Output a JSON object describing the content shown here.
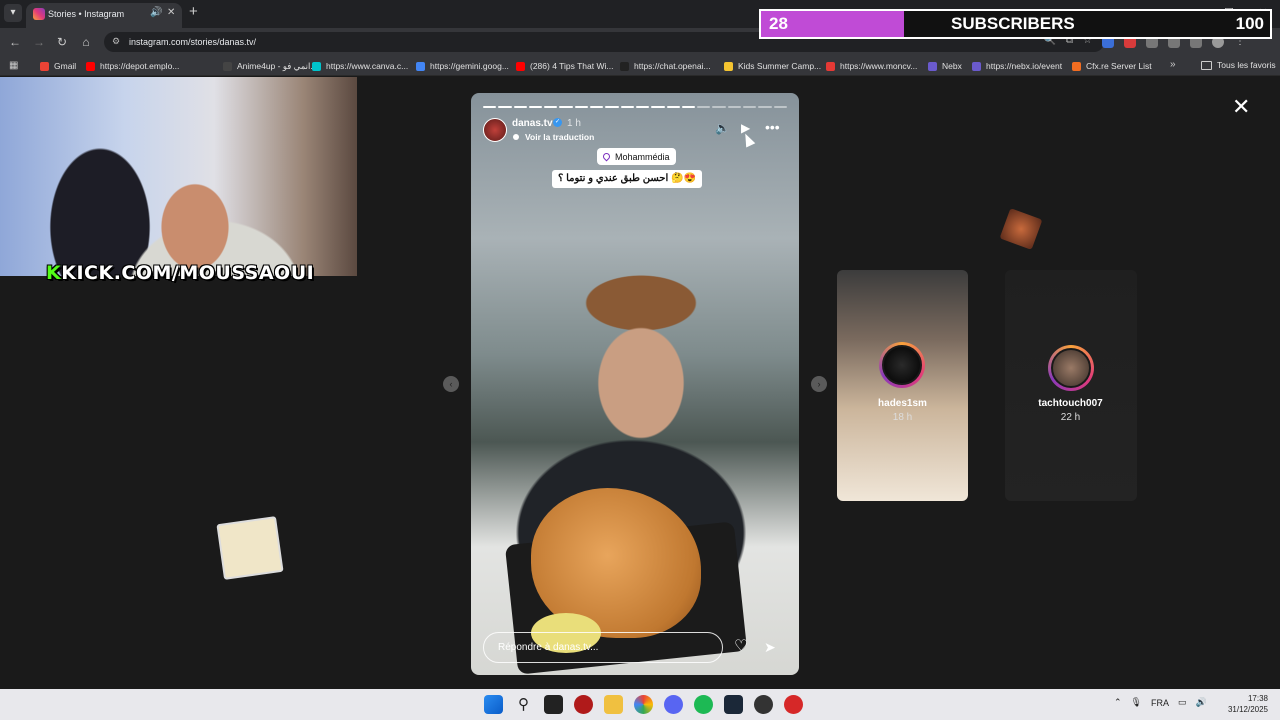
{
  "browser": {
    "tab_title": "Stories • Instagram",
    "url": "instagram.com/stories/danas.tv/",
    "bookmarks": [
      {
        "label": "Gmail",
        "color": "#ea4335"
      },
      {
        "label": "https://depot.emplo...",
        "color": "#ff0000"
      },
      {
        "label": "Anime4up - انمي فو...",
        "color": "#444444"
      },
      {
        "label": "https://www.canva.c...",
        "color": "#00c4cc"
      },
      {
        "label": "https://gemini.goog...",
        "color": "#4285f4"
      },
      {
        "label": "(286) 4 Tips That Wi...",
        "color": "#ff0000"
      },
      {
        "label": "https://chat.openai...",
        "color": "#222222"
      },
      {
        "label": "Kids Summer Camp...",
        "color": "#f4c430"
      },
      {
        "label": "https://www.moncv...",
        "color": "#e53935"
      },
      {
        "label": "Nebx",
        "color": "#6a5acd"
      },
      {
        "label": "https://nebx.io/event",
        "color": "#6a5acd"
      },
      {
        "label": "Cfx.re Server List",
        "color": "#f26d21"
      }
    ],
    "all_bookmarks": "Tous les favoris"
  },
  "story": {
    "author": "danas.tv",
    "time": "1 h",
    "translate": "Voir la traduction",
    "location": "Mohammédia",
    "caption": "احسن طبق عندي و نتوما ؟ 🤔😍",
    "reply_placeholder": "Répondre à danas.tv...",
    "progress_segments": 20,
    "progress_done": 14
  },
  "previews": [
    {
      "username": "hades1sm",
      "time": "18 h"
    },
    {
      "username": "tachtouch007",
      "time": "22 h"
    }
  ],
  "stream": {
    "kick_prefix": "K",
    "kick_text": "KICK.COM/MOUSSAOUI",
    "sub_count": "28",
    "sub_label": "SUBSCRIBERS",
    "sub_goal": "100",
    "sub_progress": 0.28
  },
  "taskbar": {
    "lang": "FRA",
    "time": "17:38",
    "date": "31/12/2025"
  },
  "colors": {
    "instagram_gradient": [
      "#f9a23b",
      "#e13a7a",
      "#8a3ab9"
    ],
    "sub_fill": "#c04bd6",
    "kick_green": "#53fc18"
  }
}
